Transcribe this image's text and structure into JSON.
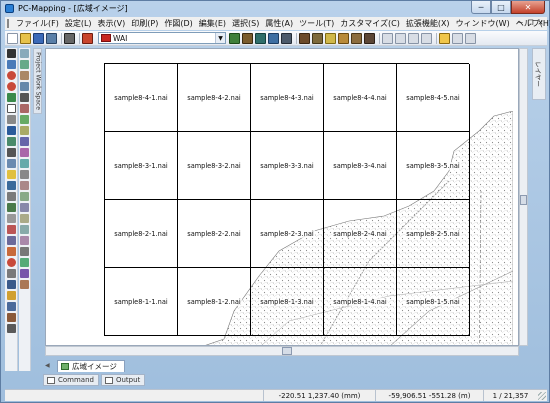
{
  "window": {
    "title": "PC-Mapping - [広域イメージ]",
    "buttons": {
      "minimize": "─",
      "maximize": "□",
      "close": "✕"
    }
  },
  "menubar": {
    "items": [
      "ファイル(F)",
      "設定(L)",
      "表示(V)",
      "印刷(P)",
      "作図(D)",
      "編集(E)",
      "選択(S)",
      "属性(A)",
      "ツール(T)",
      "カスタマイズ(C)",
      "拡張機能(X)",
      "ウィンドウ(W)",
      "ヘルプ(H)"
    ],
    "mdi_controls": [
      "─",
      "❐",
      "✕"
    ]
  },
  "toolbar": {
    "layer": {
      "name": "WAI",
      "swatch_color": "#c8261f"
    }
  },
  "left_panel": {
    "project_tab_label": "Project Work Space"
  },
  "right_panel": {
    "side_tab_label": "レイヤー"
  },
  "grid": {
    "rows": [
      [
        "sample8-4-1.nai",
        "sample8-4-2.nai",
        "sample8-4-3.nai",
        "sample8-4-4.nai",
        "sample8-4-5.nai"
      ],
      [
        "sample8-3-1.nai",
        "sample8-3-2.nai",
        "sample8-3-3.nai",
        "sample8-3-4.nai",
        "sample8-3-5.nai"
      ],
      [
        "sample8-2-1.nai",
        "sample8-2-2.nai",
        "sample8-2-3.nai",
        "sample8-2-4.nai",
        "sample8-2-5.nai"
      ],
      [
        "sample8-1-1.nai",
        "sample8-1-2.nai",
        "sample8-1-3.nai",
        "sample8-1-4.nai",
        "sample8-1-5.nai"
      ]
    ]
  },
  "document_tab": {
    "label": "広域イメージ"
  },
  "panel_tabs": {
    "command": "Command",
    "output": "Output"
  },
  "statusbar": {
    "coords": "-220.51 1,237.40 (mm)",
    "world_coords": "-59,906.51 -551.28 (m)",
    "scale": "1 / 21,357"
  },
  "colors": {
    "titlebar": "#b9d1ea",
    "frame_border": "#5e7da3",
    "canvas": "#ffffff",
    "grid_line": "#000000"
  }
}
